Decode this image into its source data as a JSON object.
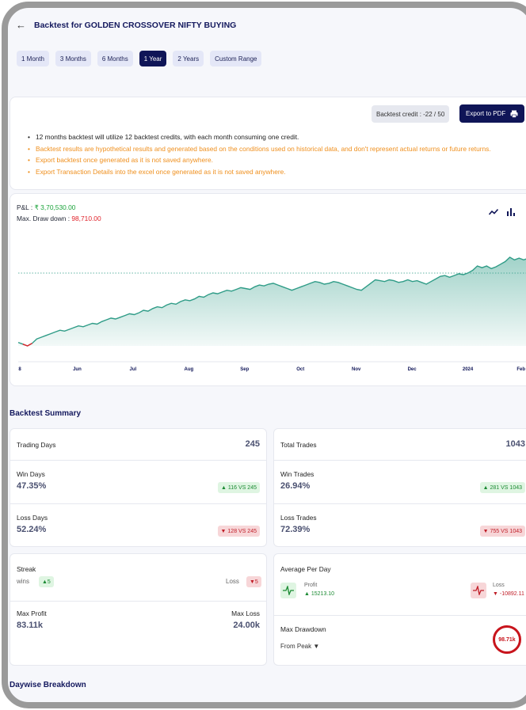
{
  "header": {
    "title": "Backtest for GOLDEN CROSSOVER NIFTY BUYING"
  },
  "ranges": [
    "1 Month",
    "3 Months",
    "6 Months",
    "1 Year",
    "2 Years",
    "Custom Range"
  ],
  "active_range": "1 Year",
  "info": {
    "credit": "Backtest credit : -22 / 50",
    "export_label": "Export to PDF",
    "notes": [
      "12 months backtest will utilize 12 backtest credits, with each month consuming one credit.",
      "Backtest results are hypothetical results and generated based on the conditions used on historical data, and don't represent actual returns or future returns.",
      "Export backtest once generated as it is not saved anywhere.",
      "Export Transaction Details into the excel once generated as it is not saved anywhere."
    ]
  },
  "pnl": {
    "label": "P&L :",
    "value": "₹ 3,70,530.00",
    "dd_label": "Max. Draw down :",
    "dd_value": "98,710.00"
  },
  "colors": {
    "navy": "#0f1557",
    "green": "#1aa33a",
    "red": "#e0222a",
    "area": "#2f9c87",
    "orange": "#ef8f1d"
  },
  "chart_data": {
    "type": "area",
    "x_ticks": [
      "8",
      "Jun",
      "Jul",
      "Aug",
      "Sep",
      "Oct",
      "Nov",
      "Dec",
      "2024",
      "Feb"
    ],
    "baseline_dotted": true,
    "values": [
      0.02,
      0.0,
      -0.02,
      0.01,
      0.06,
      0.08,
      0.1,
      0.12,
      0.14,
      0.16,
      0.15,
      0.17,
      0.19,
      0.21,
      0.2,
      0.22,
      0.24,
      0.23,
      0.26,
      0.28,
      0.3,
      0.29,
      0.31,
      0.33,
      0.35,
      0.34,
      0.36,
      0.39,
      0.38,
      0.41,
      0.43,
      0.42,
      0.45,
      0.47,
      0.46,
      0.49,
      0.51,
      0.5,
      0.52,
      0.55,
      0.54,
      0.57,
      0.59,
      0.58,
      0.6,
      0.62,
      0.61,
      0.63,
      0.65,
      0.64,
      0.63,
      0.66,
      0.68,
      0.67,
      0.69,
      0.7,
      0.68,
      0.66,
      0.64,
      0.62,
      0.64,
      0.66,
      0.68,
      0.7,
      0.72,
      0.71,
      0.69,
      0.7,
      0.72,
      0.71,
      0.69,
      0.67,
      0.65,
      0.63,
      0.62,
      0.66,
      0.7,
      0.74,
      0.73,
      0.72,
      0.74,
      0.73,
      0.71,
      0.72,
      0.74,
      0.72,
      0.73,
      0.71,
      0.69,
      0.72,
      0.75,
      0.78,
      0.79,
      0.77,
      0.79,
      0.81,
      0.8,
      0.82,
      0.85,
      0.9,
      0.88,
      0.9,
      0.87,
      0.89,
      0.92,
      0.95,
      1.0,
      0.97,
      0.99,
      0.97,
      0.99
    ]
  },
  "summary": {
    "title": "Backtest Summary",
    "trading_days_label": "Trading Days",
    "trading_days": "245",
    "win_days_label": "Win Days",
    "win_days": "47.35%",
    "win_days_pill": "▲ 116 VS 245",
    "loss_days_label": "Loss Days",
    "loss_days": "52.24%",
    "loss_days_pill": "▼ 128 VS 245",
    "total_trades_label": "Total Trades",
    "total_trades": "1043",
    "win_trades_label": "Win Trades",
    "win_trades": "26.94%",
    "win_trades_pill": "▲ 281 VS 1043",
    "loss_trades_label": "Loss Trades",
    "loss_trades": "72.39%",
    "loss_trades_pill": "▼ 755 VS 1043",
    "streak_label": "Streak",
    "wins_label": "wins",
    "wins_value": "▲5",
    "loss_label": "Loss",
    "loss_value": "▼5",
    "max_profit_label": "Max Profit",
    "max_profit": "83.11k",
    "max_loss_label": "Max Loss",
    "max_loss": "24.00k",
    "avg_per_day_label": "Average Per Day",
    "profit_label": "Profit",
    "profit_value": "▲ 15213.10",
    "loss2_label": "Loss",
    "loss2_value": "▼ -10892.11",
    "max_drawdown_label": "Max Drawdown",
    "from_peak_label": "From Peak ▼",
    "drawdown_circle": "98.71k"
  },
  "daywise": {
    "title": "Daywise Breakdown"
  }
}
